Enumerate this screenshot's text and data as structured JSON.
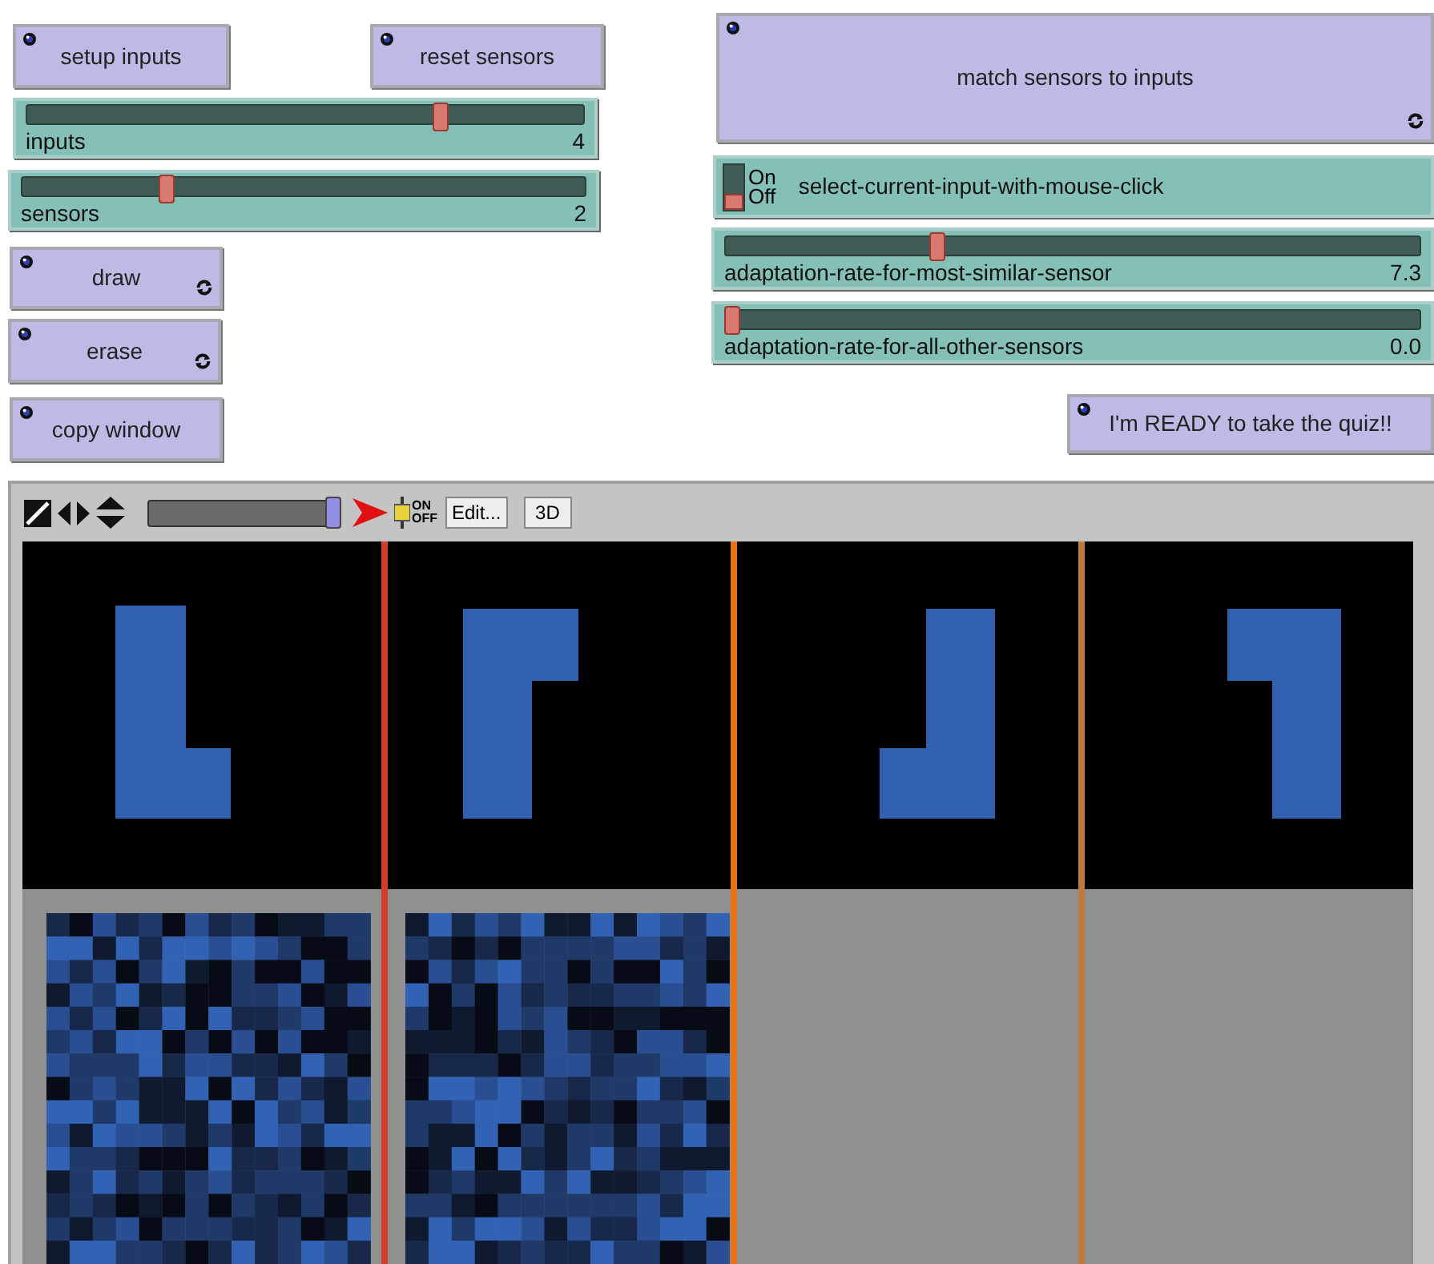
{
  "buttons_left": [
    {
      "label": "setup inputs",
      "forever": false
    },
    {
      "label": "reset sensors",
      "forever": false
    }
  ],
  "sliders_left": [
    {
      "label": "inputs",
      "value": "4",
      "level": 0.75
    },
    {
      "label": "sensors",
      "value": "2",
      "level": 0.25
    }
  ],
  "buttons_lower": [
    {
      "label": "draw",
      "forever": true
    },
    {
      "label": "erase",
      "forever": true
    },
    {
      "label": "copy window",
      "forever": false
    }
  ],
  "match_button": {
    "label": "match sensors to inputs",
    "forever": true
  },
  "switch": {
    "label": "select-current-input-with-mouse-click",
    "on": false,
    "on_label": "On",
    "off_label": "Off"
  },
  "sliders_right": [
    {
      "label": "adaptation-rate-for-most-similar-sensor",
      "value": "7.3",
      "level": 0.3
    },
    {
      "label": "adaptation-rate-for-all-other-sensors",
      "value": "0.0",
      "level": 0
    }
  ],
  "quiz_button": {
    "label": "I'm READY to take the quiz!!",
    "forever": false
  },
  "view": {
    "speed_slider": {
      "level": 1
    },
    "update_toggle": {
      "on_label": "ON",
      "off_label": "OFF"
    },
    "edit_button": "Edit...",
    "threed_button": "3D",
    "inputs": [
      {
        "kind": "l"
      },
      {
        "kind": "p"
      },
      {
        "kind": "j"
      },
      {
        "kind": "seven"
      }
    ],
    "dividers": [
      {
        "color": "#d83a2a"
      },
      {
        "color": "#e8731a"
      },
      {
        "color": "#c07a3a"
      }
    ],
    "sensors": [
      {
        "kind": "pixel-grid"
      },
      {
        "kind": "pixel-grid"
      }
    ]
  }
}
